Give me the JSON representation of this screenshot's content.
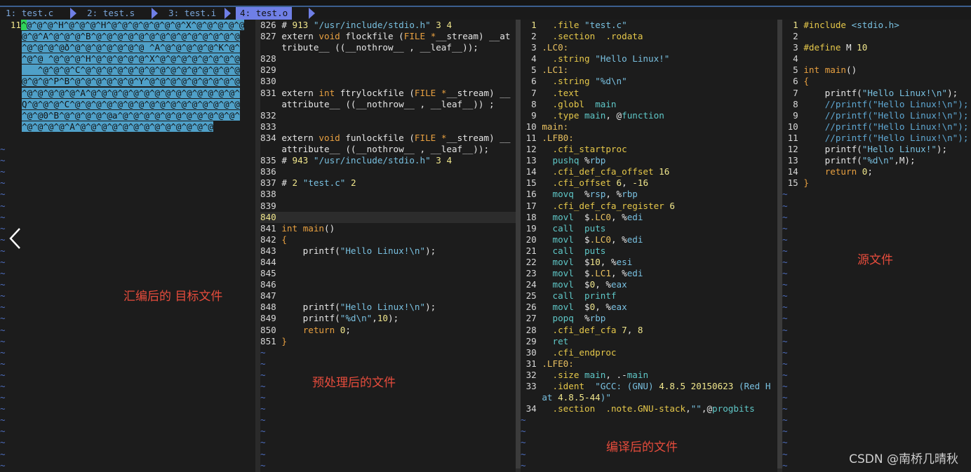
{
  "tabs": [
    {
      "label": "1: test.c",
      "active": false
    },
    {
      "label": "2: test.s",
      "active": false
    },
    {
      "label": "3: test.i",
      "active": false
    },
    {
      "label": "4: test.o",
      "active": true
    }
  ],
  "pane1": {
    "line_no": "11",
    "lines": [
      "^@^@^@^H^@^@^@^H^@^@^@^@^@^@^@^X^@^@^@^@^@",
      "@^@^A^@^@^@^B^@^@^@^@^@^@^@^@^@^@^@^@^@^@",
      "^@^@^@^@ð^@^@^@^@^@^@^@ ^A^@^@^@^@^@^K^@^",
      "^@^@ ^@^@^@^H^@^@^@^@^@^X^@^@^@^@^@^@^@^@",
      "   ^@^@^@^C^@^@^@^@^@^@^@^@^@^@^@^@^@^@^@",
      "@^@^@^P^B^@^@^@^@^@^@^Y^@^@^@^@^@^@^@^@^@",
      "^@^@^@^@^@^A^@^@^@^@^@^@^@^@^@^@^@^@^@^@^",
      "Q^@^@^@^C^@^@^@^@^@^@^@^@^@^@^@^@^@^@^@^@",
      "^@^@0^B^@^@^@^@^@a^@^@^@^@^@^@^@^@^@^@^@^",
      "^@^@^@^@^A^@^@^@^@^@^@^@^@^@^@^@^@^@"
    ],
    "annotation": "汇编后的 目标文件"
  },
  "pane2": {
    "annotation": "预处理后的文件"
  },
  "pane3": {
    "annotation": "编译后的文件"
  },
  "pane4": {
    "annotation": "源文件"
  },
  "watermark": "CSDN @南桥几晴秋"
}
